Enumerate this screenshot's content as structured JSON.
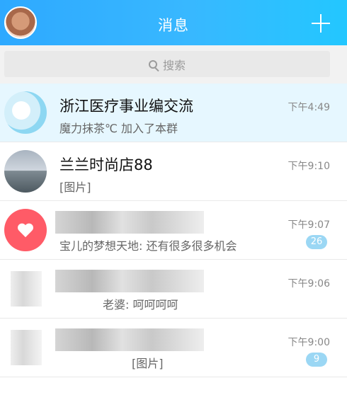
{
  "header": {
    "title": "消息",
    "left_avatar": "avatar",
    "right_icon": "plus-icon"
  },
  "search": {
    "placeholder": "搜索",
    "icon": "search-icon"
  },
  "messages": [
    {
      "name": "浙江医疗事业编交流",
      "preview": "魔力抹茶℃ 加入了本群",
      "time": "下午4:49",
      "badge": "",
      "avatar": "medical-group-avatar"
    },
    {
      "name": "兰兰时尚店88",
      "preview": "[图片]",
      "time": "下午9:10",
      "badge": "",
      "avatar": "portrait-avatar"
    },
    {
      "name": "",
      "preview": "宝儿的梦想天地: 还有很多很多机会",
      "time": "下午9:07",
      "badge": "26",
      "avatar": "heart-avatar"
    },
    {
      "name": "",
      "preview": "老婆: 呵呵呵呵",
      "time": "下午9:06",
      "badge": "",
      "avatar": "blurred-avatar"
    },
    {
      "name": "",
      "preview": "[图片]",
      "time": "下午9:00",
      "badge": "9",
      "avatar": "blurred-avatar"
    }
  ]
}
